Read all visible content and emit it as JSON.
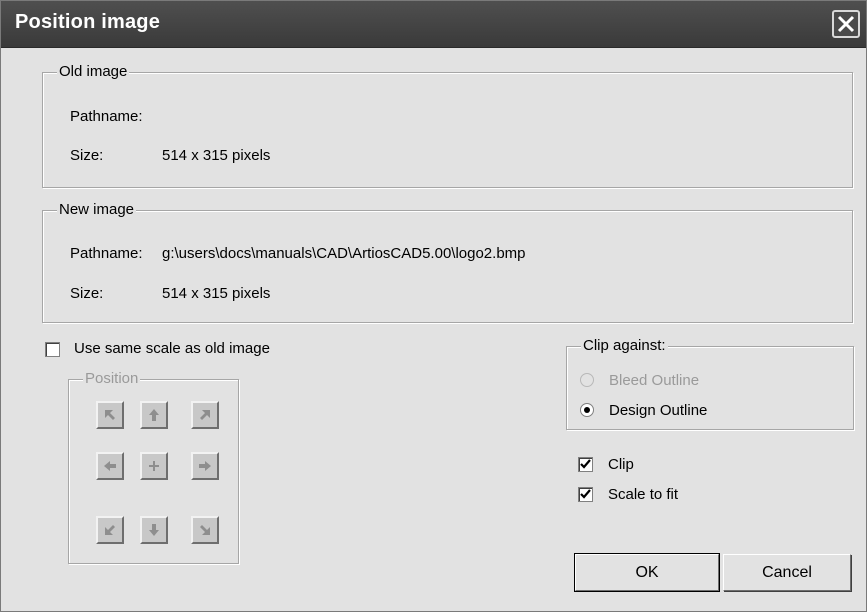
{
  "window": {
    "title": "Position image"
  },
  "old_image": {
    "legend": "Old image",
    "pathname_label": "Pathname:",
    "pathname_value": "",
    "size_label": "Size:",
    "size_value": "514 x 315 pixels"
  },
  "new_image": {
    "legend": "New image",
    "pathname_label": "Pathname:",
    "pathname_value": "g:\\users\\docs\\manuals\\CAD\\ArtiosCAD5.00\\logo2.bmp",
    "size_label": "Size:",
    "size_value": "514 x 315 pixels"
  },
  "options": {
    "use_same_scale_label": "Use same scale as old image",
    "use_same_scale_checked": false
  },
  "position": {
    "legend": "Position",
    "enabled": false,
    "buttons": [
      "up-left",
      "up",
      "up-right",
      "left",
      "center",
      "right",
      "down-left",
      "down",
      "down-right"
    ]
  },
  "clip_against": {
    "legend": "Clip against:",
    "bleed_outline_label": "Bleed Outline",
    "bleed_outline_enabled": false,
    "design_outline_label": "Design Outline",
    "selected": "Design Outline"
  },
  "checks": {
    "clip_label": "Clip",
    "clip_checked": true,
    "scale_to_fit_label": "Scale to fit",
    "scale_to_fit_checked": true
  },
  "buttons": {
    "ok_label": "OK",
    "cancel_label": "Cancel"
  }
}
